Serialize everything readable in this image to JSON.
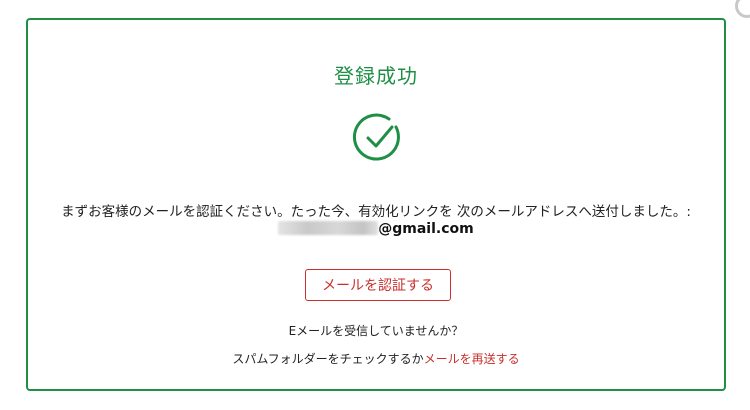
{
  "card": {
    "title": "登録成功",
    "message": "まずお客様のメールを認証ください。たった今、有効化リンクを 次のメールアドレスへ送付しました。:",
    "email_domain": "@gmail.com",
    "verify_button_label": "メールを認証する",
    "question": "Eメールを受信していませんか？",
    "spam_hint": "スパムフォルダーをチェックするか",
    "resend_link_label": "メールを再送する"
  },
  "icons": {
    "success": "check-circle-icon"
  },
  "colors": {
    "success_green": "#1f8f46",
    "accent_red": "#c9302c"
  }
}
